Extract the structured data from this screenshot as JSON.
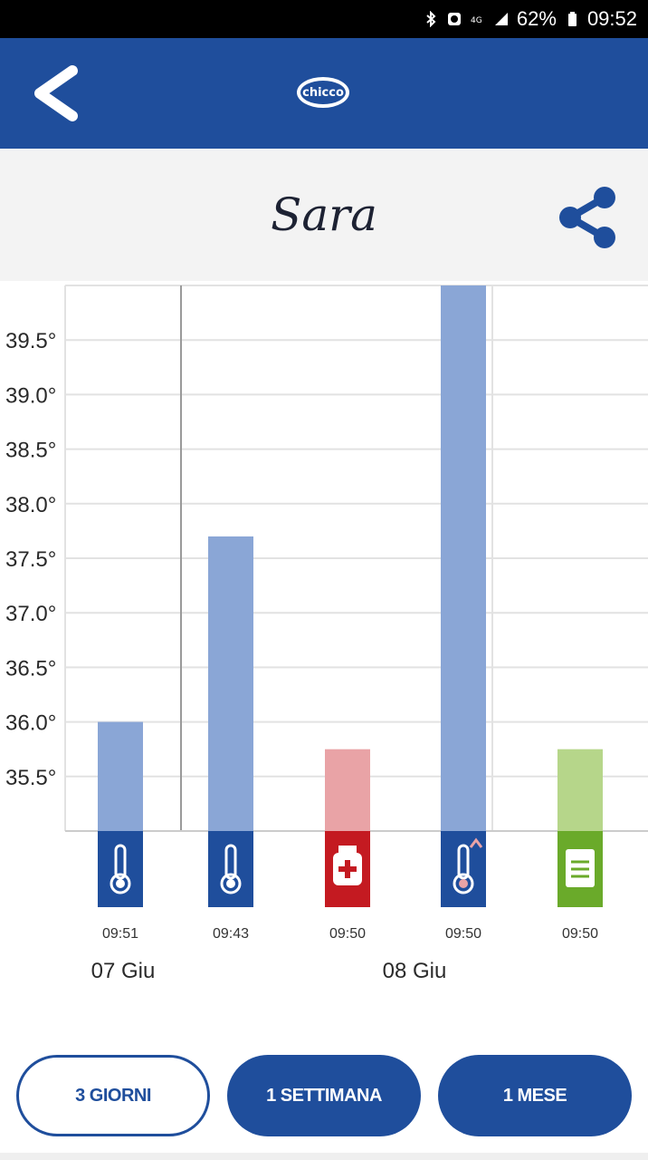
{
  "status_bar": {
    "battery": "62%",
    "time": "09:52",
    "icons": [
      "bluetooth-icon",
      "alarm-icon",
      "network-icon",
      "signal-icon",
      "battery-icon"
    ]
  },
  "app_bar": {
    "back_icon": "chevron-left-icon",
    "logo_text": "chicco",
    "color": "#1f4e9c"
  },
  "header": {
    "title": "Sara",
    "share_icon": "share-icon"
  },
  "chart_data": {
    "type": "bar",
    "title": "",
    "xlabel": "",
    "ylabel": "",
    "y_ticks": [
      "35.5°",
      "36.0°",
      "36.5°",
      "37.0°",
      "37.5°",
      "38.0°",
      "38.5°",
      "39.0°",
      "39.5°"
    ],
    "ylim": [
      35.0,
      40.0
    ],
    "grid": true,
    "bars": [
      {
        "time": "09:51",
        "value": 36.0,
        "color": "#8aa6d6",
        "icon": "thermometer-icon",
        "icon_bg": "#1f4e9c"
      },
      {
        "time": "09:43",
        "value": 37.7,
        "color": "#8aa6d6",
        "icon": "thermometer-icon",
        "icon_bg": "#1f4e9c"
      },
      {
        "time": "09:50",
        "value": 35.75,
        "color": "#e9a3a6",
        "icon": "medicine-icon",
        "icon_bg": "#c41a21"
      },
      {
        "time": "09:50",
        "value": 40.0,
        "color": "#8aa6d6",
        "icon": "fever-thermometer-icon",
        "icon_bg": "#1f4e9c"
      },
      {
        "time": "09:50",
        "value": 35.75,
        "color": "#b6d68a",
        "icon": "note-icon",
        "icon_bg": "#6aaa2a"
      }
    ],
    "day_groups": [
      {
        "label": "07 Giu",
        "bars": [
          0
        ]
      },
      {
        "label": "08 Giu",
        "bars": [
          1,
          2,
          3,
          4
        ]
      }
    ]
  },
  "range_buttons": [
    {
      "label": "3 GIORNI",
      "selected": true
    },
    {
      "label": "1 SETTIMANA",
      "selected": false
    },
    {
      "label": "1 MESE",
      "selected": false
    }
  ]
}
